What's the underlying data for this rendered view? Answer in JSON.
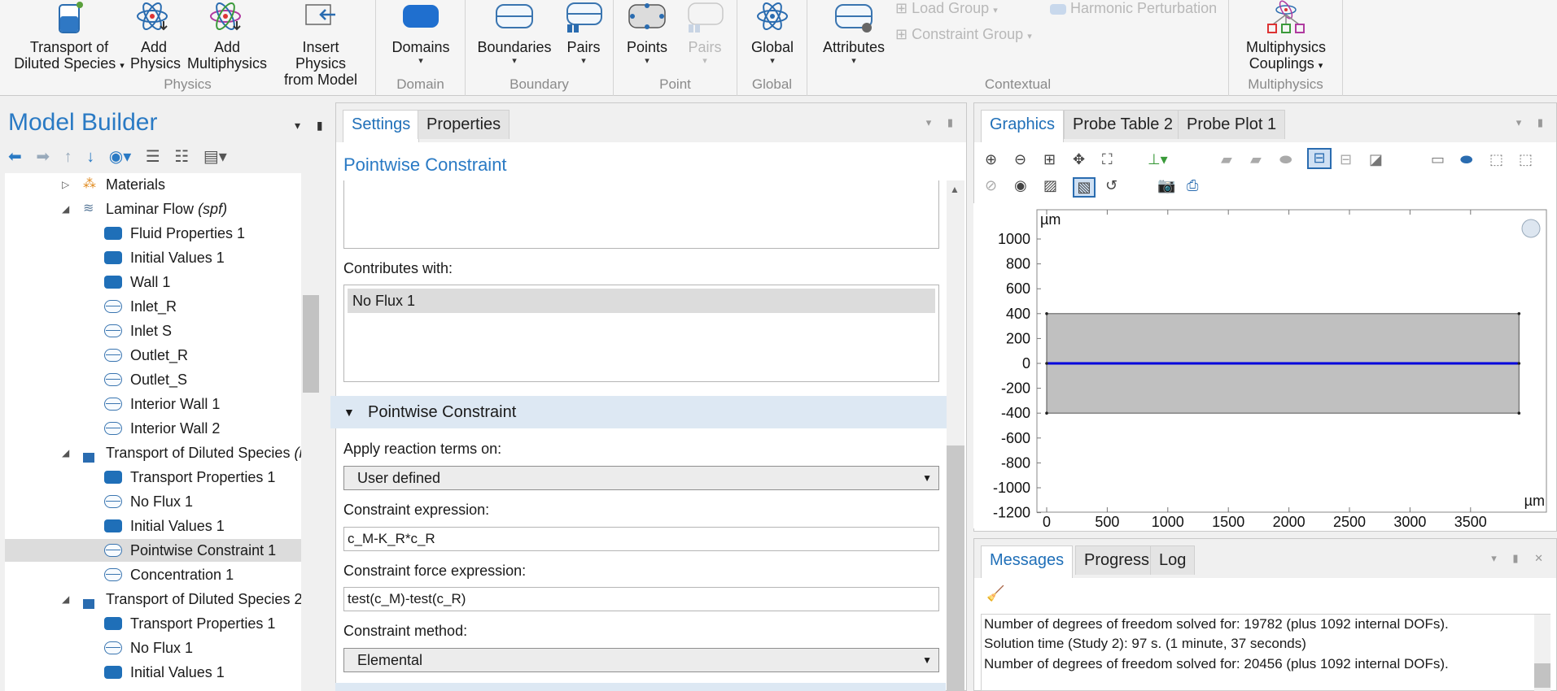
{
  "ribbon": {
    "groups": {
      "physics": "Physics",
      "domain": "Domain",
      "boundary": "Boundary",
      "point": "Point",
      "global": "Global",
      "contextual": "Contextual",
      "multiphysics": "Multiphysics"
    },
    "buttons": {
      "transport_line1": "Transport of",
      "transport_line2": "Diluted Species",
      "add_physics_line1": "Add",
      "add_physics_line2": "Physics",
      "add_multi_line1": "Add",
      "add_multi_line2": "Multiphysics",
      "insert_line1": "Insert Physics",
      "insert_line2": "from Model",
      "domains": "Domains",
      "boundaries": "Boundaries",
      "pairs_boundary": "Pairs",
      "points": "Points",
      "pairs_point": "Pairs",
      "global": "Global",
      "attributes": "Attributes",
      "load_group": "Load Group",
      "constraint_group": "Constraint Group",
      "harmonic": "Harmonic Perturbation",
      "multi_couplings_line1": "Multiphysics",
      "multi_couplings_line2": "Couplings"
    }
  },
  "model_builder": {
    "title": "Model Builder",
    "tree": [
      {
        "label": "Materials",
        "italic": ""
      },
      {
        "label": "Laminar Flow",
        "italic": "(spf)"
      },
      {
        "label": "Fluid Properties 1",
        "italic": ""
      },
      {
        "label": "Initial Values 1",
        "italic": ""
      },
      {
        "label": "Wall 1",
        "italic": ""
      },
      {
        "label": "Inlet_R",
        "italic": ""
      },
      {
        "label": "Inlet S",
        "italic": ""
      },
      {
        "label": "Outlet_R",
        "italic": ""
      },
      {
        "label": "Outlet_S",
        "italic": ""
      },
      {
        "label": "Interior Wall 1",
        "italic": ""
      },
      {
        "label": "Interior Wall 2",
        "italic": ""
      },
      {
        "label": "Transport of Diluted Species",
        "italic": "(i"
      },
      {
        "label": "Transport Properties 1",
        "italic": ""
      },
      {
        "label": "No Flux 1",
        "italic": ""
      },
      {
        "label": "Initial Values 1",
        "italic": ""
      },
      {
        "label": "Pointwise Constraint 1",
        "italic": ""
      },
      {
        "label": "Concentration 1",
        "italic": ""
      },
      {
        "label": "Transport of Diluted Species 2",
        "italic": ""
      },
      {
        "label": "Transport Properties 1",
        "italic": ""
      },
      {
        "label": "No Flux 1",
        "italic": ""
      },
      {
        "label": "Initial Values 1",
        "italic": ""
      }
    ]
  },
  "settings": {
    "tabs": {
      "settings": "Settings",
      "properties": "Properties"
    },
    "title": "Pointwise Constraint",
    "contributes_label": "Contributes with:",
    "contributes_item": "No Flux 1",
    "section": "Pointwise Constraint",
    "apply_label": "Apply reaction terms on:",
    "apply_value": "User defined",
    "expr_label": "Constraint expression:",
    "expr_value": "c_M-K_R*c_R",
    "force_label": "Constraint force expression:",
    "force_value": "test(c_M)-test(c_R)",
    "method_label": "Constraint method:",
    "method_value": "Elemental"
  },
  "graphics": {
    "tabs": {
      "graphics": "Graphics",
      "probe_table": "Probe Table 2",
      "probe_plot": "Probe Plot 1"
    },
    "unit": "µm",
    "y_ticks": [
      "1000",
      "800",
      "600",
      "400",
      "200",
      "0",
      "-200",
      "-400",
      "-600",
      "-800",
      "-1000",
      "-1200"
    ],
    "x_ticks": [
      "0",
      "500",
      "1000",
      "1500",
      "2000",
      "2500",
      "3000",
      "3500"
    ],
    "colors": {
      "domain_fill": "#c0c0c0",
      "selection_line": "#0000dd"
    }
  },
  "messages": {
    "tabs": {
      "messages": "Messages",
      "progress": "Progress",
      "log": "Log"
    },
    "lines": [
      "Number of degrees of freedom solved for: 19782 (plus 1092 internal DOFs).",
      "Solution time (Study 2): 97 s. (1 minute, 37 seconds)",
      "Number of degrees of freedom solved for: 20456 (plus 1092 internal DOFs)."
    ]
  }
}
